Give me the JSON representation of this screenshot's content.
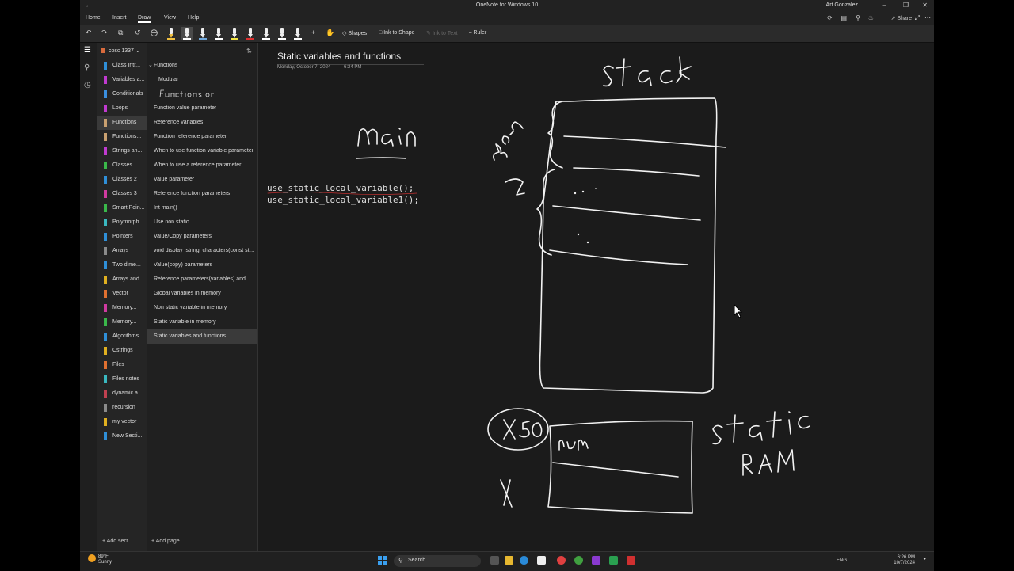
{
  "window": {
    "title": "OneNote for Windows 10",
    "user": "Art Gonzalez"
  },
  "menu": {
    "items": [
      "Home",
      "Insert",
      "Draw",
      "View",
      "Help"
    ],
    "selected": "Draw",
    "share_label": "Share"
  },
  "ribbon": {
    "shapes_label": "Shapes",
    "ink_to_shape_label": "Ink to Shape",
    "ink_to_text_label": "Ink to Text",
    "ruler_label": "Ruler",
    "pen_colors": [
      "#f0c040",
      "#ffffff",
      "#6fa8dc",
      "#ffffff",
      "#f5e642",
      "#e03030",
      "#ffffff",
      "#ffffff",
      "#ffffff"
    ]
  },
  "notebook": {
    "name": "cosc 1337",
    "add_section_label": "Add sect...",
    "sections": [
      {
        "label": "Class Intr...",
        "color": "#2f8fd8"
      },
      {
        "label": "Variables a...",
        "color": "#c03ad0"
      },
      {
        "label": "Conditionals",
        "color": "#3a8fe0"
      },
      {
        "label": "Loops",
        "color": "#c03ad0"
      },
      {
        "label": "Functions",
        "color": "#c9a070",
        "selected": true
      },
      {
        "label": "Functions...",
        "color": "#c9a070"
      },
      {
        "label": "Strings an...",
        "color": "#c03ad0"
      },
      {
        "label": "Classes",
        "color": "#3ab84a"
      },
      {
        "label": "Classes 2",
        "color": "#2f8fd8"
      },
      {
        "label": "Classes 3",
        "color": "#d03aa0"
      },
      {
        "label": "Smart Poin...",
        "color": "#3ab84a"
      },
      {
        "label": "Polymorph...",
        "color": "#3ab8c0"
      },
      {
        "label": "Pointers",
        "color": "#2f8fd8"
      },
      {
        "label": "Arrays",
        "color": "#8a8a8a"
      },
      {
        "label": "Two dime...",
        "color": "#2f8fd8"
      },
      {
        "label": "Arrays and...",
        "color": "#e0b020"
      },
      {
        "label": "Vector",
        "color": "#e07030"
      },
      {
        "label": "Memory...",
        "color": "#d03aa0"
      },
      {
        "label": "Memory...",
        "color": "#3ab84a"
      },
      {
        "label": "Algorithms",
        "color": "#2f8fd8"
      },
      {
        "label": "Cstrings",
        "color": "#e0b020"
      },
      {
        "label": "Files",
        "color": "#e07030"
      },
      {
        "label": "Files notes",
        "color": "#3ab8c0"
      },
      {
        "label": "dynamic a...",
        "color": "#c04050"
      },
      {
        "label": "recursion",
        "color": "#8a8a8a"
      },
      {
        "label": "my vector",
        "color": "#e0b020"
      },
      {
        "label": "New Secti...",
        "color": "#2f8fd8"
      }
    ]
  },
  "pages": {
    "add_page_label": "Add page",
    "items": [
      {
        "label": "Functions",
        "level": 0,
        "collapsible": true
      },
      {
        "label": "Modular",
        "level": 1
      },
      {
        "label": "",
        "level": 1,
        "ink_title": true
      },
      {
        "label": "Function value parameter",
        "level": 0
      },
      {
        "label": "Reference variables",
        "level": 0
      },
      {
        "label": "Function reference parameter",
        "level": 0
      },
      {
        "label": "When to use function variable parameter",
        "level": 0
      },
      {
        "label": "When to use a reference parameter",
        "level": 0
      },
      {
        "label": "Value parameter",
        "level": 0
      },
      {
        "label": "Reference function parameters",
        "level": 0
      },
      {
        "label": "Int main()",
        "level": 0
      },
      {
        "label": "Use non static",
        "level": 0
      },
      {
        "label": "Value/Copy parameters",
        "level": 0
      },
      {
        "label": "void display_string_characters(const strin...",
        "level": 0
      },
      {
        "label": "Value(copy) parameters",
        "level": 0
      },
      {
        "label": "Reference parameters(variables) and me...",
        "level": 0
      },
      {
        "label": "Global variables in memory",
        "level": 0
      },
      {
        "label": "Non static variable in memory",
        "level": 0
      },
      {
        "label": "Static variable in memory",
        "level": 0
      },
      {
        "label": "Static variables and functions",
        "level": 0,
        "selected": true
      }
    ]
  },
  "page": {
    "title": "Static variables and functions",
    "date": "Monday, October 7, 2024",
    "time": "6:24 PM",
    "code_lines": [
      "use_static_local_variable();",
      "use_static_local_variable1();"
    ]
  },
  "taskbar": {
    "weather_temp": "89°F",
    "weather_desc": "Sunny",
    "search_label": "Search",
    "lang": "ENG",
    "time": "6:26 PM",
    "date": "10/7/2024"
  }
}
